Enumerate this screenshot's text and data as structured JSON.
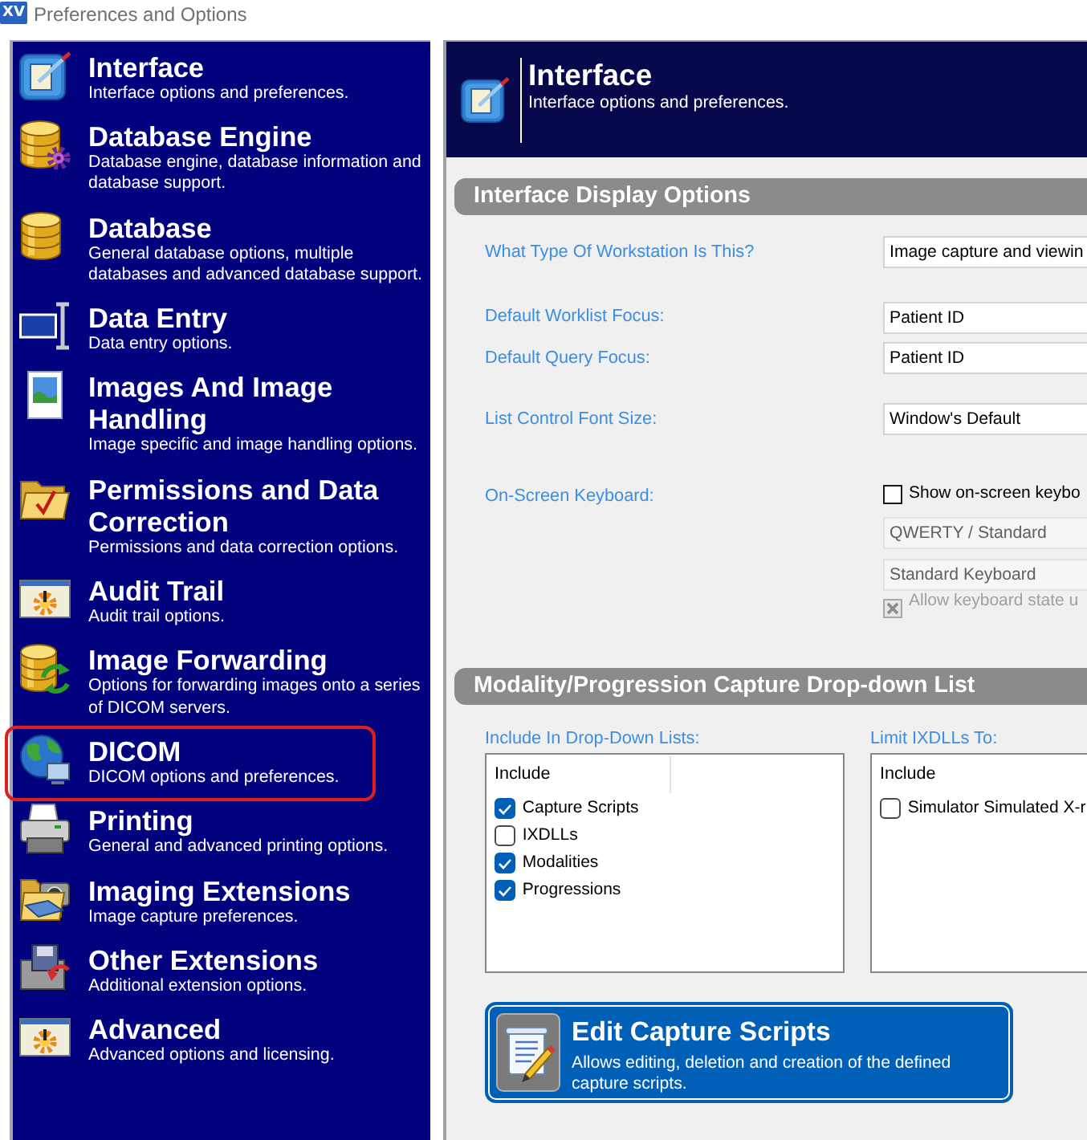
{
  "window": {
    "logo": "XV",
    "title": "Preferences and Options"
  },
  "sidebar": {
    "items": [
      {
        "title": "Interface",
        "description": "Interface options and preferences.",
        "highlighted": false
      },
      {
        "title": "Database Engine",
        "description": "Database engine, database information and database support.",
        "highlighted": false
      },
      {
        "title": "Database",
        "description": "General database options, multiple databases and advanced database support.",
        "highlighted": false
      },
      {
        "title": "Data Entry",
        "description": "Data entry options.",
        "highlighted": false
      },
      {
        "title": "Images And Image Handling",
        "description": "Image specific and image handling options.",
        "highlighted": false
      },
      {
        "title": "Permissions and Data Correction",
        "description": "Permissions and data correction options.",
        "highlighted": false
      },
      {
        "title": "Audit Trail",
        "description": "Audit trail options.",
        "highlighted": false
      },
      {
        "title": "Image Forwarding",
        "description": "Options for forwarding images onto a series of DICOM servers.",
        "highlighted": false
      },
      {
        "title": "DICOM",
        "description": "DICOM options and preferences.",
        "highlighted": true
      },
      {
        "title": "Printing",
        "description": "General and advanced printing options.",
        "highlighted": false
      },
      {
        "title": "Imaging Extensions",
        "description": "Image capture preferences.",
        "highlighted": false
      },
      {
        "title": "Other Extensions",
        "description": "Additional extension options.",
        "highlighted": false
      },
      {
        "title": "Advanced",
        "description": "Advanced options and licensing.",
        "highlighted": false
      }
    ]
  },
  "header": {
    "title": "Interface",
    "description": "Interface options and preferences."
  },
  "display_options": {
    "title": "Interface Display Options",
    "rows": [
      {
        "kind": "select",
        "label": "What Type Of Workstation Is This?",
        "value": "Image capture and viewin"
      },
      {
        "kind": "select",
        "label": "Default Worklist Focus:",
        "value": "Patient ID"
      },
      {
        "kind": "select",
        "label": "Default Query Focus:",
        "value": "Patient ID"
      },
      {
        "kind": "select",
        "label": "List Control Font Size:",
        "value": "Window's Default"
      },
      {
        "kind": "keyboard",
        "label": "On-Screen Keyboard:",
        "show": {
          "label": "Show on-screen keybo",
          "checked": false,
          "disabled": false
        },
        "layout": {
          "value": "QWERTY / Standard",
          "disabled": true
        },
        "keyboard": {
          "value": "Standard Keyboard",
          "disabled": true
        },
        "allow_state": {
          "label": "Allow keyboard state u",
          "checked": true,
          "disabled": true
        }
      }
    ]
  },
  "capture_list": {
    "title": "Modality/Progression Capture Drop-down List",
    "lists": [
      {
        "label": "Include In Drop-Down Lists:",
        "column": "Include",
        "items": [
          {
            "label": "Capture Scripts",
            "checked": true
          },
          {
            "label": "IXDLLs",
            "checked": false
          },
          {
            "label": "Modalities",
            "checked": true
          },
          {
            "label": "Progressions",
            "checked": true
          }
        ]
      },
      {
        "label": "Limit IXDLLs To:",
        "column": "Include",
        "items": [
          {
            "label": "Simulator Simulated X-r",
            "checked": false
          }
        ]
      }
    ],
    "button": {
      "title": "Edit Capture Scripts",
      "description": "Allows editing, deletion and creation of the defined capture scripts."
    }
  }
}
